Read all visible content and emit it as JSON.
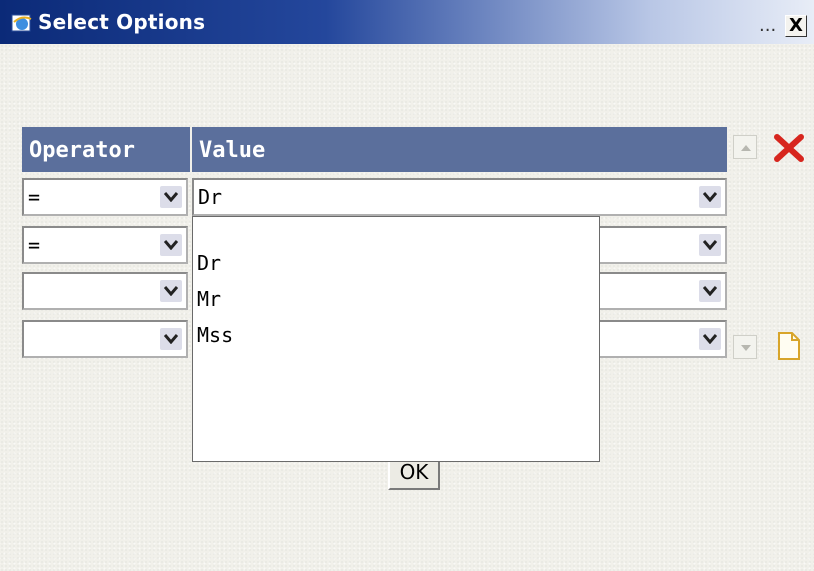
{
  "window": {
    "title": "Select Options",
    "title_ellipsis": "...",
    "close_label": "X",
    "title_icon": "ie-icon"
  },
  "grid": {
    "headers": {
      "operator": "Operator",
      "value": "Value"
    },
    "rows": [
      {
        "operator": "=",
        "value": "Dr"
      },
      {
        "operator": "=",
        "value": ""
      },
      {
        "operator": "",
        "value": ""
      },
      {
        "operator": "",
        "value": ""
      }
    ]
  },
  "dropdown": {
    "options": [
      "Dr",
      "Mr",
      "Mss"
    ]
  },
  "buttons": {
    "ok": "OK",
    "move_up_icon": "arrow-up-icon",
    "delete_icon": "delete-x-icon",
    "move_down_icon": "arrow-down-icon",
    "new_icon": "new-document-icon"
  },
  "colors": {
    "header_bg": "#5b6f9c",
    "delete_red": "#d7261e",
    "titlebar_dark": "#0b2a78"
  }
}
